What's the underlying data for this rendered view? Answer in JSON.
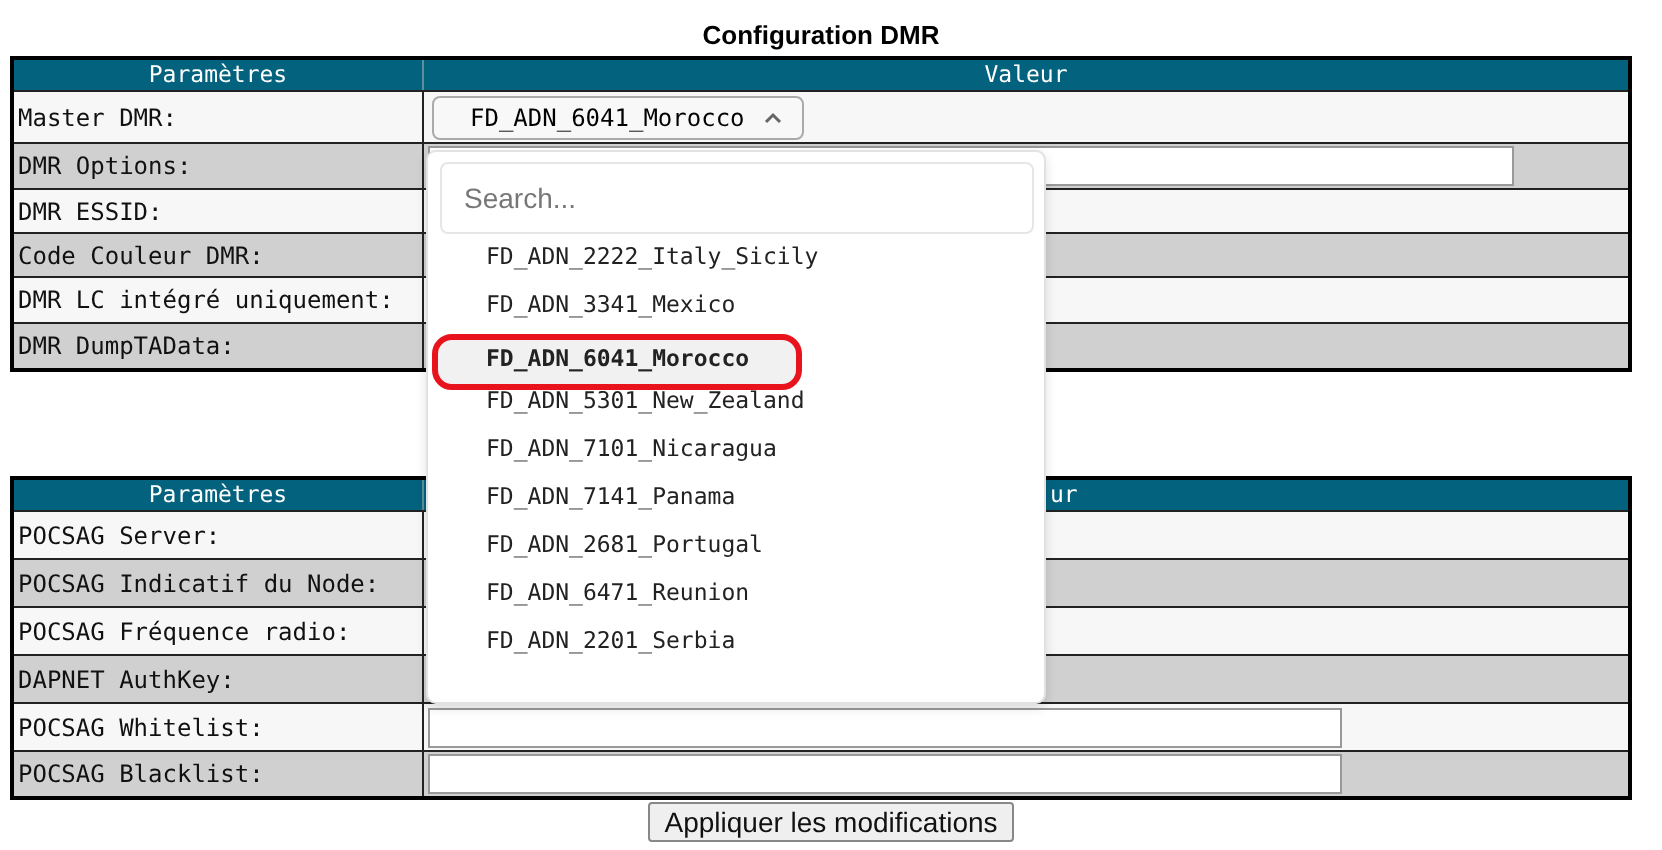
{
  "title": "Configuration DMR",
  "dmr_table": {
    "columns": [
      "Paramètres",
      "Valeur"
    ],
    "rows": [
      {
        "label": "Master DMR:",
        "kind": "select",
        "value": "FD_ADN_6041_Morocco"
      },
      {
        "label": "DMR Options:",
        "kind": "input"
      },
      {
        "label": "DMR ESSID:",
        "kind": "blank"
      },
      {
        "label": "Code Couleur DMR:",
        "kind": "blank"
      },
      {
        "label": "DMR LC intégré uniquement:",
        "kind": "blank"
      },
      {
        "label": "DMR DumpTAData:",
        "kind": "blank"
      }
    ]
  },
  "pocsag_table": {
    "columns": [
      "Paramètres",
      "ur"
    ],
    "rows": [
      {
        "label": "POCSAG Server:",
        "kind": "blank"
      },
      {
        "label": "POCSAG Indicatif du Node:",
        "kind": "blank"
      },
      {
        "label": "POCSAG Fréquence radio:",
        "kind": "blank"
      },
      {
        "label": "DAPNET AuthKey:",
        "kind": "blank"
      },
      {
        "label": "POCSAG Whitelist:",
        "kind": "input"
      },
      {
        "label": "POCSAG Blacklist:",
        "kind": "input"
      }
    ]
  },
  "dropdown": {
    "placeholder": "Search...",
    "items": [
      {
        "label": "FD_ADN_2222_Italy_Sicily",
        "selected": false,
        "circled": false
      },
      {
        "label": "FD_ADN_3341_Mexico",
        "selected": false,
        "circled": false
      },
      {
        "label": "FD_ADN_6041_Morocco",
        "selected": true,
        "circled": true
      },
      {
        "label": "FD_ADN_5301_New_Zealand",
        "selected": false,
        "circled": false
      },
      {
        "label": "FD_ADN_7101_Nicaragua",
        "selected": false,
        "circled": false
      },
      {
        "label": "FD_ADN_7141_Panama",
        "selected": false,
        "circled": false
      },
      {
        "label": "FD_ADN_2681_Portugal",
        "selected": false,
        "circled": false
      },
      {
        "label": "FD_ADN_6471_Reunion",
        "selected": false,
        "circled": false
      },
      {
        "label": "FD_ADN_2201_Serbia",
        "selected": false,
        "circled": false
      }
    ]
  },
  "apply_button": "Appliquer les modifications"
}
